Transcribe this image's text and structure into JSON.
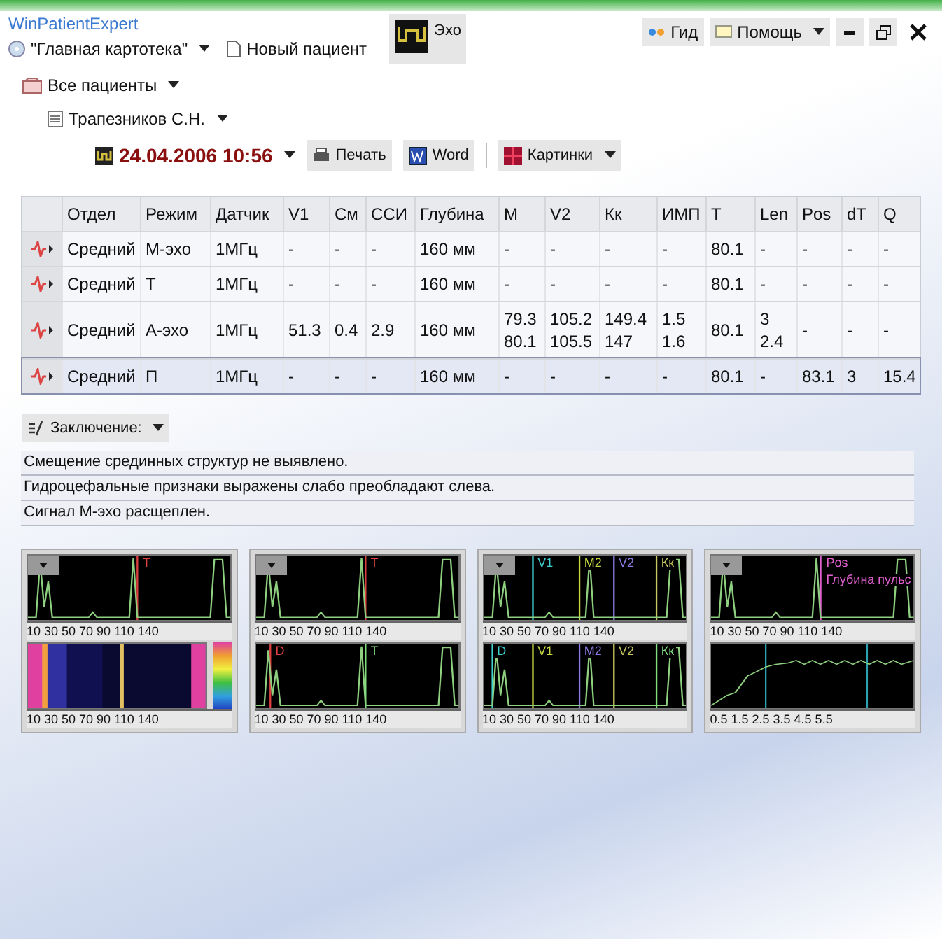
{
  "app_title": "WinPatientExpert",
  "toolbar": {
    "card_selector": "\"Главная картотека\"",
    "new_patient": "Новый пациент",
    "echo_button": "Эхо",
    "guide": "Гид",
    "help": "Помощь"
  },
  "tree": {
    "all_patients": "Все пациенты",
    "patient": "Трапезников С.Н.",
    "exam_date": "24.04.2006 10:56",
    "buttons": [
      {
        "kind": "print",
        "label": "Печать"
      },
      {
        "kind": "word",
        "label": "Word"
      },
      {
        "kind": "pictures",
        "label": "Картинки"
      }
    ]
  },
  "table": {
    "columns": [
      "Отдел",
      "Режим",
      "Датчик",
      "V1",
      "См",
      "ССИ",
      "Глубина",
      "М",
      "V2",
      "Кк",
      "ИМП",
      "T",
      "Len",
      "Pos",
      "dT",
      "Q"
    ],
    "rows": [
      {
        "selected": false,
        "cells": [
          "Средний",
          "М-эхо",
          "1МГц",
          "-",
          "-",
          "-",
          "160 мм",
          "-",
          "-",
          "-",
          "-",
          "80.1",
          "-",
          "-",
          "-",
          "-"
        ]
      },
      {
        "selected": false,
        "cells": [
          "Средний",
          "Т",
          "1МГц",
          "-",
          "-",
          "-",
          "160 мм",
          "-",
          "-",
          "-",
          "-",
          "80.1",
          "-",
          "-",
          "-",
          "-"
        ]
      },
      {
        "selected": false,
        "cells": [
          "Средний",
          "А-эхо",
          "1МГц",
          "51.3",
          "0.4",
          "2.9",
          "160 мм",
          "79.3\n80.1",
          "105.2\n105.5",
          "149.4\n147",
          "1.5\n1.6",
          "80.1",
          "3\n2.4",
          "-",
          "-",
          "-"
        ]
      },
      {
        "selected": true,
        "cells": [
          "Средний",
          "П",
          "1МГц",
          "-",
          "-",
          "-",
          "160 мм",
          "-",
          "-",
          "-",
          "-",
          "80.1",
          "-",
          "83.1",
          "3",
          "15.4"
        ]
      }
    ]
  },
  "conclusion": {
    "label": "Заключение:",
    "lines": [
      "Смещение срединных структур не выявлено.",
      "Гидроцефальные признаки выражены слабо преобладают слева.",
      "Сигнал М-эхо расщеплен."
    ]
  },
  "panels": [
    {
      "top": {
        "kind": "trace",
        "markers": [
          "T"
        ],
        "axis": "10 30 50 70 90 110 140"
      },
      "bottom": {
        "kind": "spectrogram",
        "axis": "10 30 50 70 90 110 140"
      }
    },
    {
      "top": {
        "kind": "trace",
        "markers": [
          "T"
        ],
        "axis": "10 30 50 70 90 110 140"
      },
      "bottom": {
        "kind": "trace",
        "markers": [
          "D",
          "T"
        ],
        "axis": "10 30 50 70 90 110 140"
      }
    },
    {
      "top": {
        "kind": "trace",
        "markers": [
          "V1",
          "M2",
          "V2",
          "Кк"
        ],
        "axis": "10 30 50 70 90 110 140"
      },
      "bottom": {
        "kind": "trace",
        "markers": [
          "D",
          "V1",
          "M2",
          "V2",
          "Кк"
        ],
        "axis": "10 30 50 70 90 110 140"
      }
    },
    {
      "top": {
        "kind": "trace",
        "markers": [
          "Pos",
          "Глубина пульс"
        ],
        "axis": "10 30 50 70 90 110 140"
      },
      "bottom": {
        "kind": "pulse",
        "axis": "0.5 1.5 2.5 3.5 4.5 5.5"
      }
    }
  ]
}
